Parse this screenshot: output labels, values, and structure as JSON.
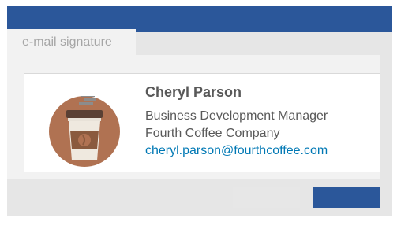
{
  "window": {
    "accent_color": "#2b579a"
  },
  "tab": {
    "label": "e-mail signature"
  },
  "signature": {
    "name": "Cheryl Parson",
    "title": "Business Development Manager",
    "company": "Fourth Coffee Company",
    "email": "cheryl.parson@fourthcoffee.com",
    "avatar_icon": "coffee-cup-icon",
    "email_color": "#0078b4"
  },
  "buttons": {
    "secondary_label": "",
    "primary_label": ""
  }
}
